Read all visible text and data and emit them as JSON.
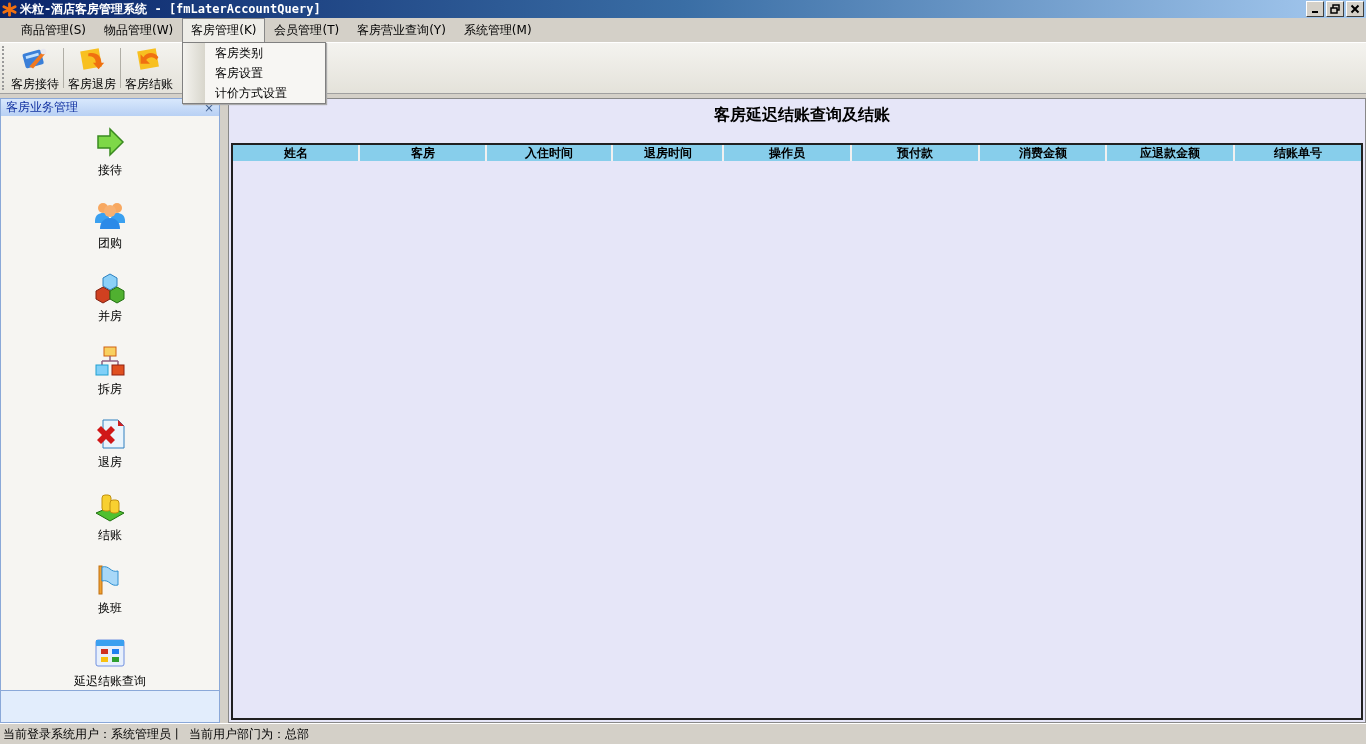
{
  "window": {
    "title": "米粒-酒店客房管理系统 - [fmLaterAccountQuery]"
  },
  "menu": [
    {
      "label": "商品管理(S)",
      "selected": false
    },
    {
      "label": "物品管理(W)",
      "selected": false
    },
    {
      "label": "客房管理(K)",
      "selected": true
    },
    {
      "label": "会员管理(T)",
      "selected": false
    },
    {
      "label": "客房营业查询(Y)",
      "selected": false
    },
    {
      "label": "系统管理(M)",
      "selected": false
    }
  ],
  "dropdown": {
    "items": [
      "客房类别",
      "客房设置",
      "计价方式设置"
    ]
  },
  "toolbar": [
    {
      "label": "客房接待",
      "kind": "reception"
    },
    {
      "label": "客房退房",
      "kind": "checkout"
    },
    {
      "label": "客房结账",
      "kind": "settle"
    }
  ],
  "sidebar": {
    "title": "客房业务管理",
    "close": "×",
    "items": [
      {
        "label": "接待",
        "kind": "arrow"
      },
      {
        "label": "团购",
        "kind": "group"
      },
      {
        "label": "并房",
        "kind": "cubes"
      },
      {
        "label": "拆房",
        "kind": "tree"
      },
      {
        "label": "退房",
        "kind": "delete"
      },
      {
        "label": "结账",
        "kind": "coins"
      },
      {
        "label": "换班",
        "kind": "flag"
      },
      {
        "label": "延迟结账查询",
        "kind": "grid"
      }
    ]
  },
  "main": {
    "title": "客房延迟结账查询及结账",
    "table": {
      "columns": [
        "姓名",
        "客房",
        "入住时间",
        "退房时间",
        "操作员",
        "预付款",
        "消费金额",
        "应退款金额",
        "结账单号"
      ]
    }
  },
  "status_bar": [
    "当前登录系统用户：系统管理员丨",
    "当前用户部门为：总部"
  ]
}
